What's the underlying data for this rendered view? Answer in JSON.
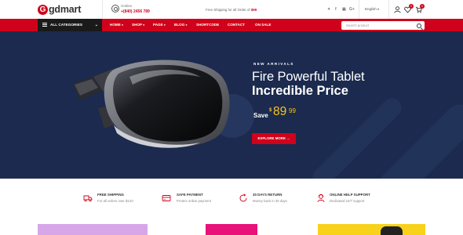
{
  "header": {
    "logo_letter": "G",
    "logo_text": "gdmart",
    "hotline_label": "Hotline",
    "hotline_phone": "+(840) 2456 789",
    "shipping_text": "Free Shipping for all Order of",
    "shipping_amount": "$99",
    "social": [
      "twitter-icon",
      "facebook-icon",
      "instagram-icon",
      "google-plus-icon"
    ],
    "language": "English",
    "wishlist_count": "0",
    "cart_count": "0"
  },
  "nav": {
    "categories_label": "ALL CATEGORIES",
    "items": [
      "HOME",
      "SHOP",
      "PAGE",
      "BLOG",
      "SHORTCODE",
      "CONTACT",
      "ON SALE"
    ],
    "search_placeholder": "Search product"
  },
  "hero": {
    "eyebrow": "NEW ARRIVALS",
    "title_line1": "Fire Powerful Tablet",
    "title_line2": "Incredible Price",
    "save_label": "Save",
    "currency": "$",
    "price_main": "89",
    "price_cents": "99",
    "button_label": "EXPLORE MORE"
  },
  "features": [
    {
      "icon": "truck-icon",
      "title": "FREE SHIPPING",
      "subtitle": "For all orders over $120"
    },
    {
      "icon": "credit-card-icon",
      "title": "SAFE PAYMENT",
      "subtitle": "Protect online payment"
    },
    {
      "icon": "return-icon",
      "title": "30 DAYS RETURN",
      "subtitle": "Money back in 30 days"
    },
    {
      "icon": "support-icon",
      "title": "ONLINE HELP SUPPORT",
      "subtitle": "Dedicated 24/7 support"
    }
  ],
  "colors": {
    "brand_red": "#d0021b",
    "hero_bg": "#1b2a4e",
    "price_yellow": "#f7c519",
    "card_lavender": "#d7a6e8",
    "card_pink": "#e8127a",
    "card_yellow": "#f8d21a"
  }
}
